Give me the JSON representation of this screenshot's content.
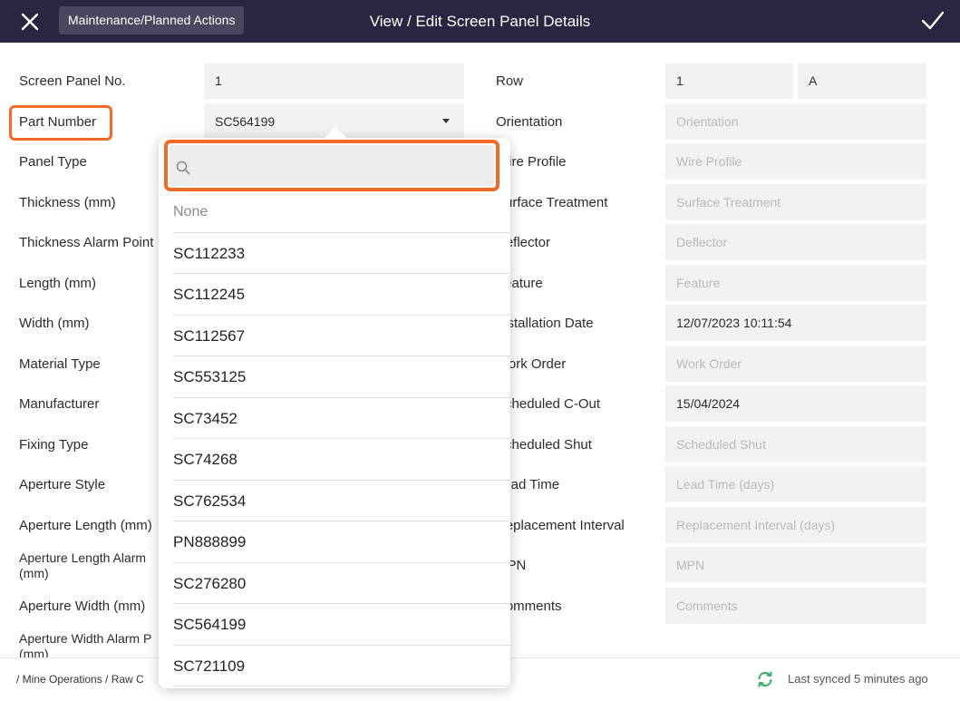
{
  "header": {
    "close_icon": "close-icon",
    "breadcrumb": "Maintenance/Planned Actions",
    "title": "View / Edit Screen Panel Details",
    "save_icon": "checkmark-icon"
  },
  "left_fields": [
    {
      "label": "Screen Panel No.",
      "value": "1"
    },
    {
      "label": "Part Number",
      "value": "SC564199"
    },
    {
      "label": "Panel Type",
      "value": ""
    },
    {
      "label": "Thickness (mm)",
      "value": ""
    },
    {
      "label": "Thickness Alarm Point",
      "value": ""
    },
    {
      "label": "Length (mm)",
      "value": ""
    },
    {
      "label": "Width (mm)",
      "value": ""
    },
    {
      "label": "Material Type",
      "value": ""
    },
    {
      "label": "Manufacturer",
      "value": ""
    },
    {
      "label": "Fixing Type",
      "value": ""
    },
    {
      "label": "Aperture Style",
      "value": ""
    },
    {
      "label": "Aperture Length (mm)",
      "value": ""
    },
    {
      "label": "Aperture Length Alarm (mm)",
      "value": ""
    },
    {
      "label": "Aperture Width (mm)",
      "value": ""
    },
    {
      "label": "Aperture Width Alarm P (mm)",
      "value": ""
    }
  ],
  "right_fields": [
    {
      "label": "Row",
      "value": "1",
      "value2": "A",
      "placeholder": ""
    },
    {
      "label": "Orientation",
      "value": "",
      "placeholder": "Orientation"
    },
    {
      "label": "Wire Profile",
      "value": "",
      "placeholder": "Wire Profile"
    },
    {
      "label": "Surface Treatment",
      "value": "",
      "placeholder": "Surface Treatment"
    },
    {
      "label": "Deflector",
      "value": "",
      "placeholder": "Deflector"
    },
    {
      "label": "Feature",
      "value": "",
      "placeholder": "Feature"
    },
    {
      "label": "Installation Date",
      "value": "12/07/2023 10:11:54",
      "placeholder": ""
    },
    {
      "label": "Work Order",
      "value": "",
      "placeholder": "Work Order"
    },
    {
      "label": "Scheduled C-Out",
      "value": "15/04/2024",
      "placeholder": ""
    },
    {
      "label": "Scheduled Shut",
      "value": "",
      "placeholder": "Scheduled Shut"
    },
    {
      "label": "Lead Time",
      "value": "",
      "placeholder": "Lead Time (days)"
    },
    {
      "label": "Replacement Interval",
      "value": "",
      "placeholder": "Replacement Interval (days)"
    },
    {
      "label": "MPN",
      "value": "",
      "placeholder": "MPN"
    },
    {
      "label": "Comments",
      "value": "",
      "placeholder": "Comments"
    }
  ],
  "dropdown": {
    "search_icon": "search-icon",
    "search_value": "",
    "options": [
      "None",
      "SC112233",
      "SC112245",
      "SC112567",
      "SC553125",
      "SC73452",
      "SC74268",
      "SC762534",
      "PN888899",
      "SC276280",
      "SC564199",
      "SC721109"
    ]
  },
  "footer": {
    "breadcrumb": "/  Mine Operations  /  Raw C",
    "sync_icon": "sync-icon",
    "sync_status": "Last synced 5 minutes ago"
  },
  "colors": {
    "header_bg": "#2a2540",
    "highlight": "#f06a2a",
    "sync_green": "#3db26b"
  }
}
